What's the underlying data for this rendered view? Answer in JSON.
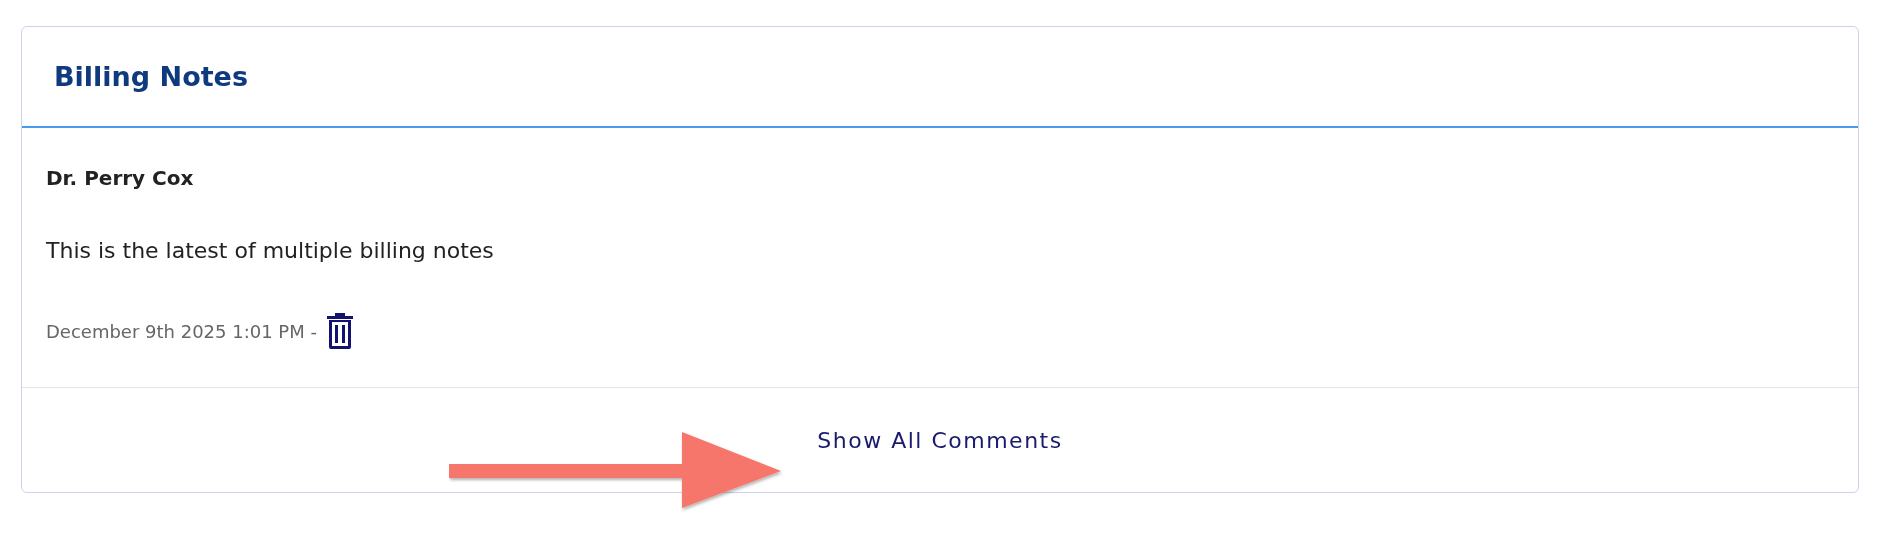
{
  "card": {
    "title": "Billing Notes"
  },
  "note": {
    "author": "Dr. Perry Cox",
    "text": "This is the latest of multiple billing notes",
    "timestamp": "December 9th 2025 1:01 PM -"
  },
  "footer": {
    "link": "Show All Comments"
  }
}
